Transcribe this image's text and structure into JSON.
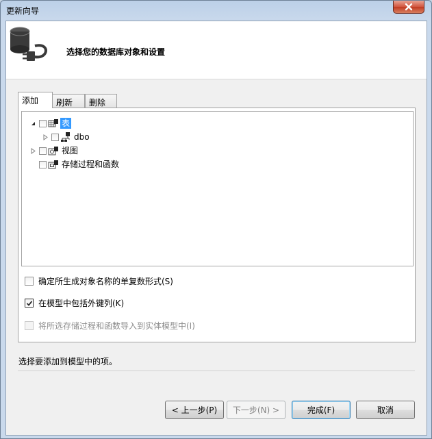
{
  "window": {
    "title": "更新向导"
  },
  "header": {
    "title": "选择您的数据库对象和设置"
  },
  "tabs": [
    {
      "label": "添加",
      "active": true
    },
    {
      "label": "刷新",
      "active": false
    },
    {
      "label": "删除",
      "active": false
    }
  ],
  "tree": {
    "tables": {
      "label": "表",
      "expanded": true,
      "checked": false,
      "selected": true
    },
    "dbo": {
      "label": "dbo",
      "expanded": false,
      "checked": false
    },
    "views": {
      "label": "视图",
      "expanded": false,
      "checked": false
    },
    "procs": {
      "label": "存储过程和函数",
      "checked": false
    }
  },
  "options": {
    "pluralize": {
      "label": "确定所生成对象名称的单复数形式(S)",
      "checked": false
    },
    "foreign_keys": {
      "label": "在模型中包括外键列(K)",
      "checked": true
    },
    "import_procs": {
      "label": "将所选存储过程和函数导入到实体模型中(I)",
      "checked": false,
      "disabled": true
    }
  },
  "hint": "选择要添加到模型中的项。",
  "buttons": {
    "back": "< 上一步(P)",
    "next": "下一步(N) >",
    "finish": "完成(F)",
    "cancel": "取消"
  },
  "colors": {
    "selection": "#3399ff",
    "close_button": "#c13a22"
  },
  "icons": {
    "header": "database-plug-icon",
    "close": "close-x-icon"
  }
}
